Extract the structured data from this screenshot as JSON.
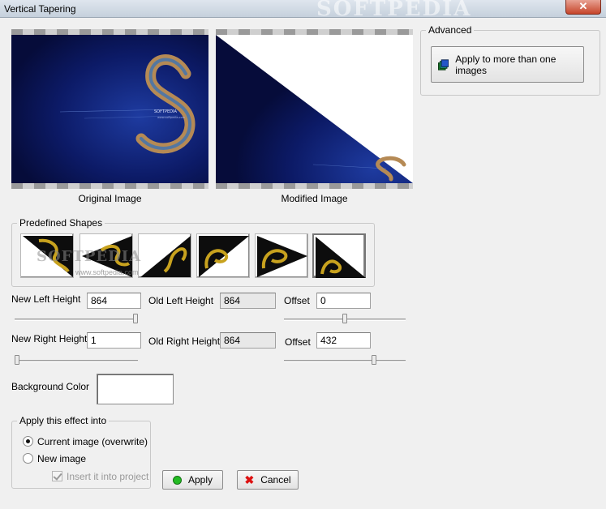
{
  "window": {
    "title": "Vertical Tapering",
    "watermark": "SOFTPEDIA",
    "close_glyph": "✕"
  },
  "preview": {
    "original_caption": "Original Image",
    "modified_caption": "Modified Image",
    "image_text_line1": "SOFTPEDIA",
    "image_text_line2": "www.softpedia.com"
  },
  "advanced": {
    "legend": "Advanced",
    "apply_many_label": "Apply to more than one images",
    "apply_many_icon": "stacked-images-icon"
  },
  "predefined_shapes": {
    "legend": "Predefined Shapes",
    "watermark": "SOFTPEDIA",
    "watermark_url": "www.softpedia.com",
    "shapes": [
      "taper-left-bottom",
      "arrow-left",
      "taper-right-top",
      "taper-top-right",
      "arrow-right",
      "taper-diagonal"
    ],
    "selected_index": 5
  },
  "heights": {
    "new_left_label": "New Left Height",
    "new_left_value": "864",
    "old_left_label": "Old Left Height",
    "old_left_value": "864",
    "offset1_label": "Offset",
    "offset1_value": "0",
    "new_right_label": "New Right Height",
    "new_right_value": "1",
    "old_right_label": "Old Right Height",
    "old_right_value": "864",
    "offset2_label": "Offset",
    "offset2_value": "432",
    "left_slider_level": 1.0,
    "offset1_slider_level": 0.5,
    "right_slider_level": 0.0,
    "offset2_slider_level": 0.75
  },
  "background": {
    "label": "Background Color",
    "color": "#ffffff"
  },
  "apply_into": {
    "legend": "Apply this effect into",
    "option_current": "Current image (overwrite)",
    "option_new": "New image",
    "insert_project": "Insert it into project",
    "selected": "current",
    "insert_checked": true
  },
  "actions": {
    "apply_label": "Apply",
    "cancel_label": "Cancel",
    "apply_icon": "green-dot-icon",
    "cancel_icon": "red-x-icon"
  },
  "colors": {
    "image_bg": "#0b1450",
    "ring": "#b58a55",
    "accent_green": "#22bb22",
    "cancel_red": "#dd1111"
  }
}
